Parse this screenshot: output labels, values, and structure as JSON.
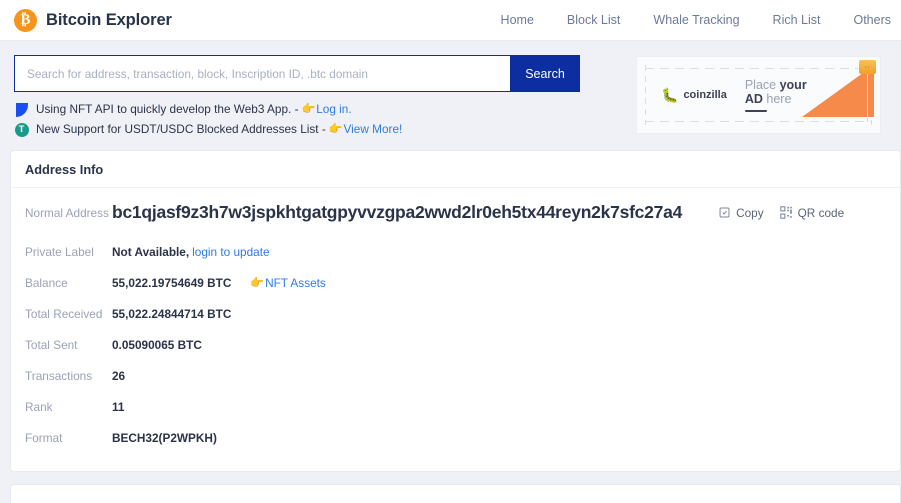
{
  "header": {
    "logo_glyph": "₿",
    "brand": "Bitcoin Explorer",
    "nav": [
      {
        "label": "Home"
      },
      {
        "label": "Block List"
      },
      {
        "label": "Whale Tracking"
      },
      {
        "label": "Rich List"
      },
      {
        "label": "Others"
      }
    ]
  },
  "search": {
    "placeholder": "Search for address, transaction, block, Inscription ID, .btc domain",
    "value": "",
    "button": "Search"
  },
  "notices": [
    {
      "icon": "blue-flag-icon",
      "text": "Using NFT API to quickly develop the Web3 App. -",
      "hand": "👉",
      "link": "Log in."
    },
    {
      "icon": "tether-icon",
      "icon_glyph": "T",
      "text": "New Support for USDT/USDC Blocked Addresses List -",
      "hand": "👉",
      "link": "View More!"
    }
  ],
  "ad": {
    "brand": "coinzilla",
    "brand_mark": "🐛",
    "headline_1": "Place ",
    "headline_1_bold": "your",
    "headline_2_bold": "AD ",
    "headline_2": "here",
    "badge": "··"
  },
  "address_info": {
    "title": "Address Info",
    "address_label": "Normal Address",
    "address": "bc1qjasf9z3h7w3jspkhtgatgpyvvzgpa2wwd2lr0eh5tx44reyn2k7sfc27a4",
    "copy_label": "Copy",
    "qr_label": "QR code",
    "rows": [
      {
        "label": "Private Label",
        "value": "Not Available,",
        "link": "login to update"
      },
      {
        "label": "Balance",
        "value": "55,022.19754649 BTC",
        "nft_hand": "👉",
        "nft_link": "NFT Assets"
      },
      {
        "label": "Total Received",
        "value": "55,022.24844714 BTC"
      },
      {
        "label": "Total Sent",
        "value": "0.05090065 BTC"
      },
      {
        "label": "Transactions",
        "value": "26"
      },
      {
        "label": "Rank",
        "value": "11"
      },
      {
        "label": "Format",
        "value": "BECH32(P2WPKH)"
      }
    ]
  },
  "colors": {
    "brand_orange": "#f7941d",
    "primary_blue": "#0c2ea0",
    "link_blue": "#2f7ce8",
    "page_bg": "#eff1f6",
    "text_dark": "#2b3348",
    "text_muted": "#9aa2b4"
  }
}
